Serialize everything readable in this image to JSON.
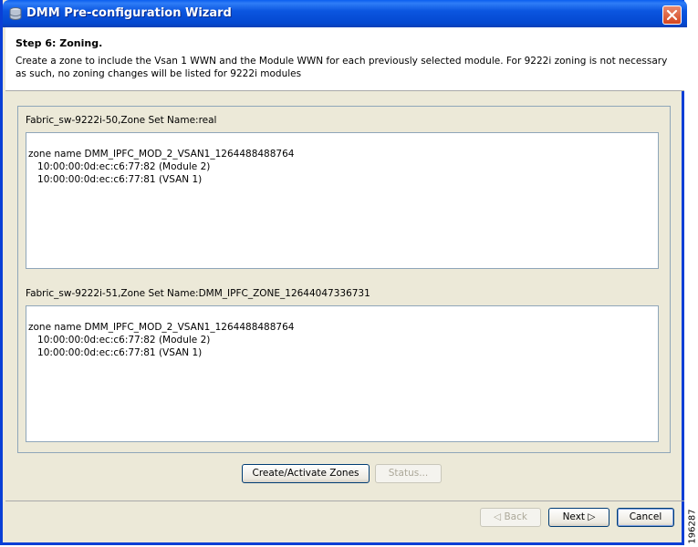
{
  "window": {
    "title": "DMM Pre-configuration Wizard"
  },
  "header": {
    "step_title": "Step 6: Zoning.",
    "description": "Create a zone to include the Vsan 1 WWN and the Module WWN for each previously selected module. For 9222i zoning is not necessary as such, no zoning changes will be listed for 9222i modules"
  },
  "fabrics": [
    {
      "label": "Fabric_sw-9222i-50,Zone Set Name:real",
      "lines": [
        "zone name DMM_IPFC_MOD_2_VSAN1_1264488488764",
        "   10:00:00:0d:ec:c6:77:82 (Module 2)",
        "   10:00:00:0d:ec:c6:77:81 (VSAN 1)"
      ]
    },
    {
      "label": "Fabric_sw-9222i-51,Zone Set Name:DMM_IPFC_ZONE_12644047336731",
      "lines": [
        "zone name DMM_IPFC_MOD_2_VSAN1_1264488488764",
        "   10:00:00:0d:ec:c6:77:82 (Module 2)",
        "   10:00:00:0d:ec:c6:77:81 (VSAN 1)"
      ]
    }
  ],
  "actions": {
    "create_label": "Create/Activate Zones",
    "status_label": "Status..."
  },
  "nav": {
    "back_label": "◁ Back",
    "next_label": "Next ▷",
    "cancel_label": "Cancel"
  },
  "figure_id": "196287"
}
